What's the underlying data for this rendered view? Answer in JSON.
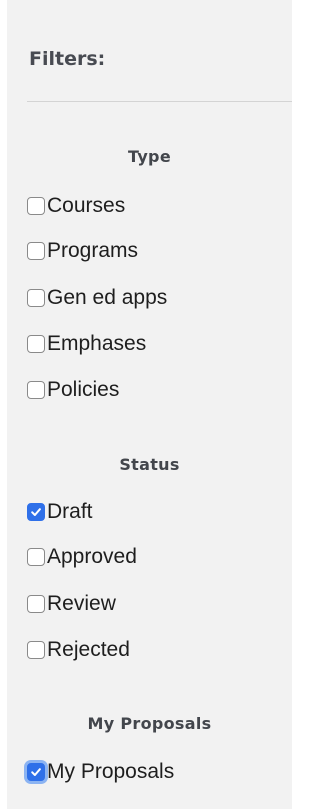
{
  "filters": {
    "title": "Filters:",
    "groups": [
      {
        "heading": "Type",
        "options": [
          {
            "label": "Courses",
            "checked": false
          },
          {
            "label": "Programs",
            "checked": false
          },
          {
            "label": "Gen ed apps",
            "checked": false
          },
          {
            "label": "Emphases",
            "checked": false
          },
          {
            "label": "Policies",
            "checked": false
          }
        ]
      },
      {
        "heading": "Status",
        "options": [
          {
            "label": "Draft",
            "checked": true
          },
          {
            "label": "Approved",
            "checked": false
          },
          {
            "label": "Review",
            "checked": false
          },
          {
            "label": "Rejected",
            "checked": false
          }
        ]
      },
      {
        "heading": "My Proposals",
        "options": [
          {
            "label": "My Proposals",
            "checked": true,
            "focused": true
          }
        ]
      }
    ]
  },
  "colors": {
    "panel_background": "#f2f2f2",
    "checkbox_accent": "#2f70e9",
    "focus_ring": "#8cb4f2",
    "heading_text": "#43464c"
  }
}
